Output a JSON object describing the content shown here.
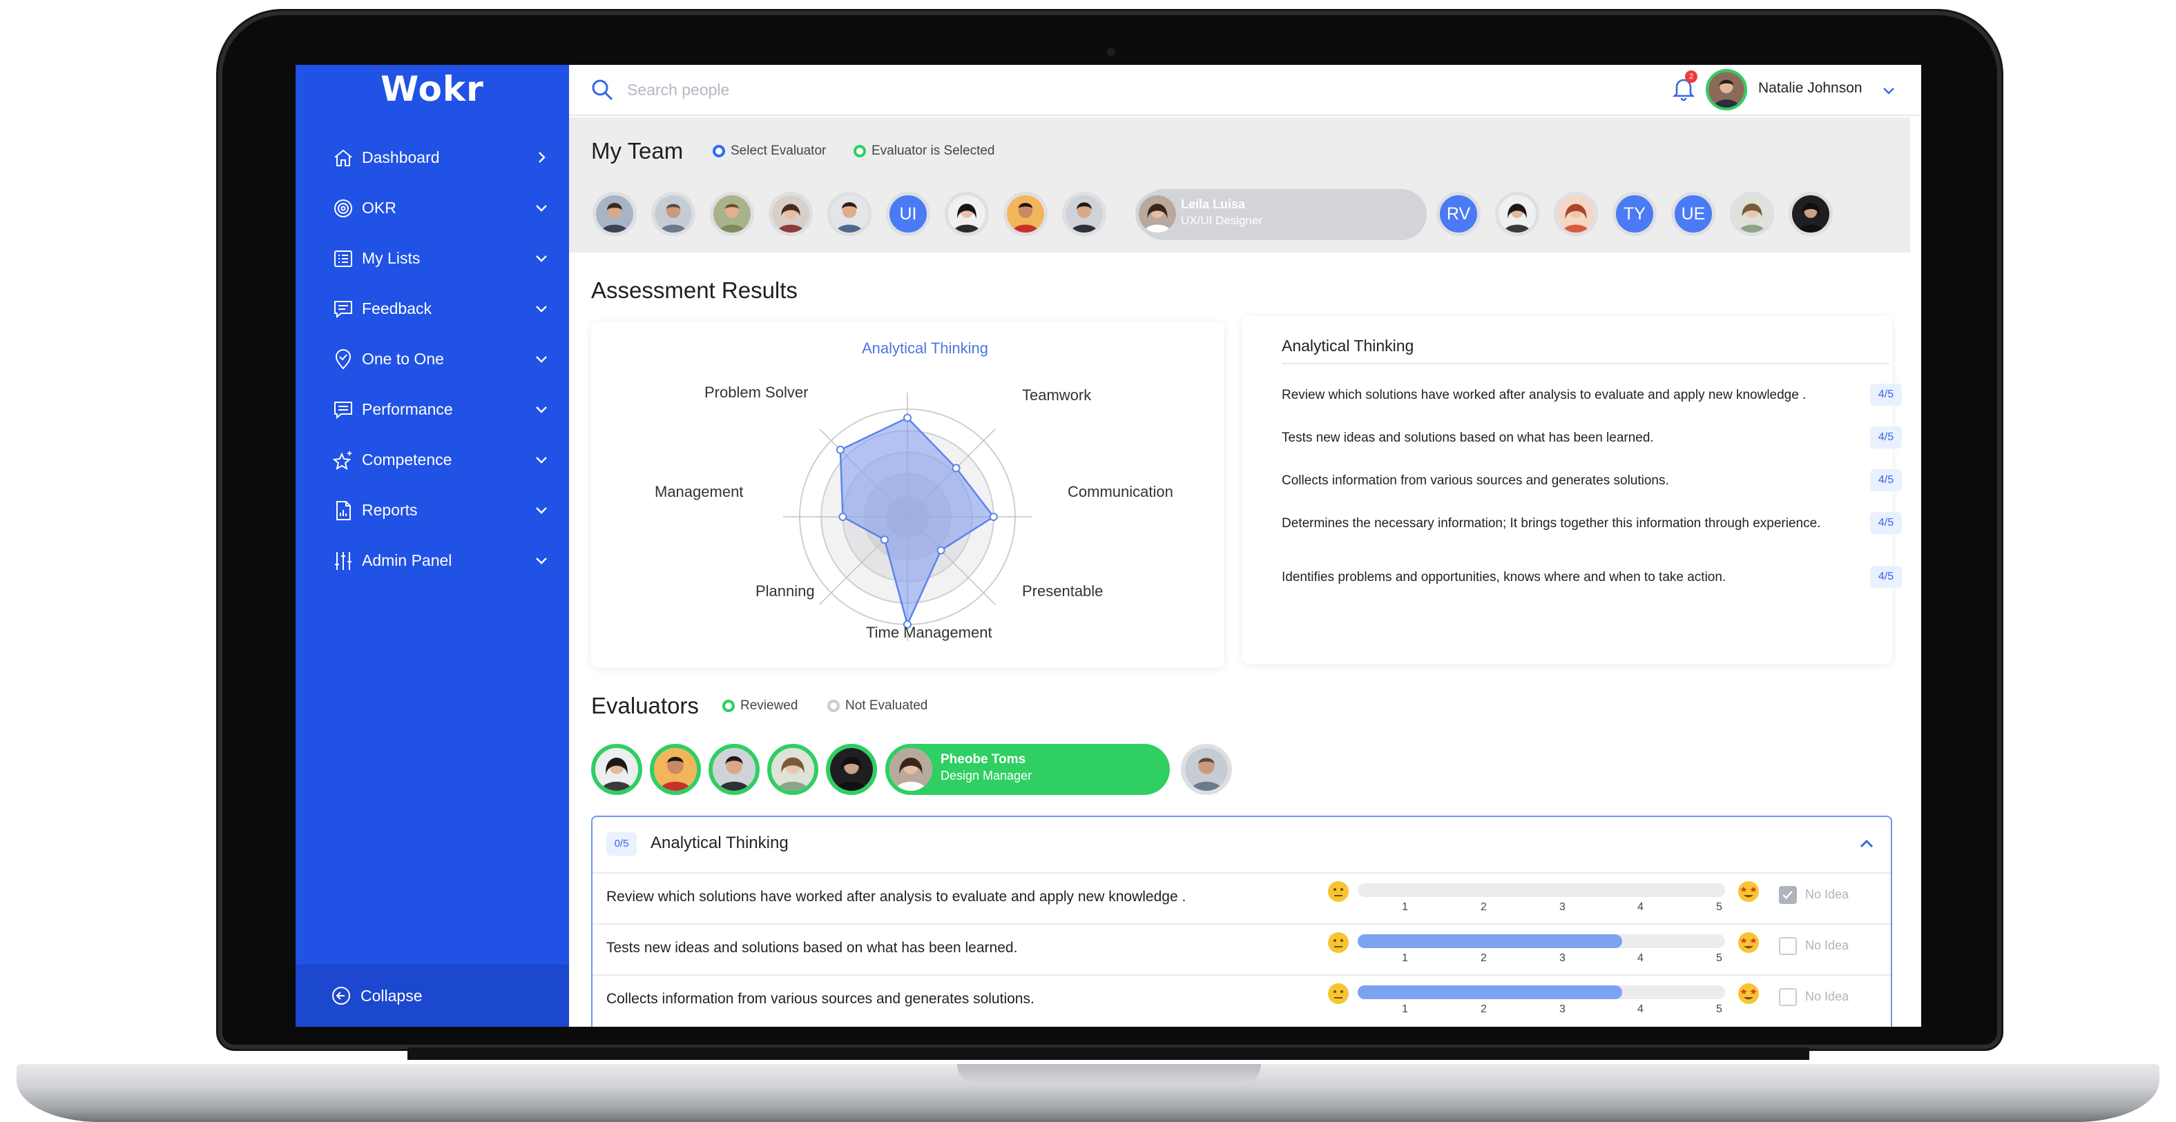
{
  "app": {
    "logo": "Wokr"
  },
  "sidebar": {
    "items": [
      {
        "label": "Dashboard",
        "icon": "home-icon",
        "chevron": "right"
      },
      {
        "label": "OKR",
        "icon": "target-icon",
        "chevron": "down"
      },
      {
        "label": "My Lists",
        "icon": "list-icon",
        "chevron": "down"
      },
      {
        "label": "Feedback",
        "icon": "feedback-icon",
        "chevron": "down"
      },
      {
        "label": "One to One",
        "icon": "location-check-icon",
        "chevron": "down"
      },
      {
        "label": "Performance",
        "icon": "message-icon",
        "chevron": "down"
      },
      {
        "label": "Competence",
        "icon": "star-icon",
        "chevron": "down"
      },
      {
        "label": "Reports",
        "icon": "report-icon",
        "chevron": "down"
      },
      {
        "label": "Admin Panel",
        "icon": "sliders-icon",
        "chevron": "down"
      }
    ],
    "collapse_label": "Collapse"
  },
  "topbar": {
    "search_placeholder": "Search people",
    "notification_count": "2",
    "user_name": "Natalie Johnson"
  },
  "team": {
    "title": "My Team",
    "legend_select": "Select Evaluator",
    "legend_selected": "Evaluator is Selected",
    "initials": [
      "UI",
      "RV",
      "TY",
      "UE"
    ],
    "selected_name": "Leila Luisa",
    "selected_role": "UX/UI Designer"
  },
  "assessment": {
    "title": "Assessment Results",
    "radar_labels": [
      "Analytical Thinking",
      "Teamwork",
      "Communication",
      "Presentable",
      "Time Management",
      "Planning",
      "Management",
      "Problem Solver"
    ],
    "radar_values": [
      4.6,
      3.2,
      4.0,
      2.2,
      5.0,
      1.5,
      3.0,
      4.4
    ],
    "radar_max": 5,
    "panel_title": "Analytical Thinking",
    "items": [
      {
        "text": "Review which solutions have worked after analysis to evaluate and apply new knowledge .",
        "score": "4/5"
      },
      {
        "text": "Tests new ideas and solutions based on what has been learned.",
        "score": "4/5"
      },
      {
        "text": "Collects information from various sources and generates solutions.",
        "score": "4/5"
      },
      {
        "text": "Determines the necessary information; It brings together this information through experience.",
        "score": "4/5"
      },
      {
        "text": "Identifies problems and opportunities, knows where and when to take action.",
        "score": "4/5"
      }
    ]
  },
  "evaluators": {
    "title": "Evaluators",
    "legend_reviewed": "Reviewed",
    "legend_not": "Not Evaluated",
    "selected_name": "Pheobe Toms",
    "selected_role": "Design Manager"
  },
  "accordion": {
    "badge": "0/5",
    "title": "Analytical Thinking",
    "no_idea_label": "No Idea",
    "scale": [
      "1",
      "2",
      "3",
      "4",
      "5"
    ],
    "rows": [
      {
        "text": "Review which solutions have worked after analysis to evaluate and apply new knowledge .",
        "value": 0,
        "no_idea": true
      },
      {
        "text": "Tests new ideas and solutions based on what has been learned.",
        "value": 4,
        "no_idea": false
      },
      {
        "text": "Collects information from various sources and generates solutions.",
        "value": 4,
        "no_idea": false
      }
    ]
  },
  "colors": {
    "brand": "#2152e6",
    "reviewed": "#2fcf62",
    "accent": "#3467e8",
    "radar_fill": "#7e9cf2"
  }
}
